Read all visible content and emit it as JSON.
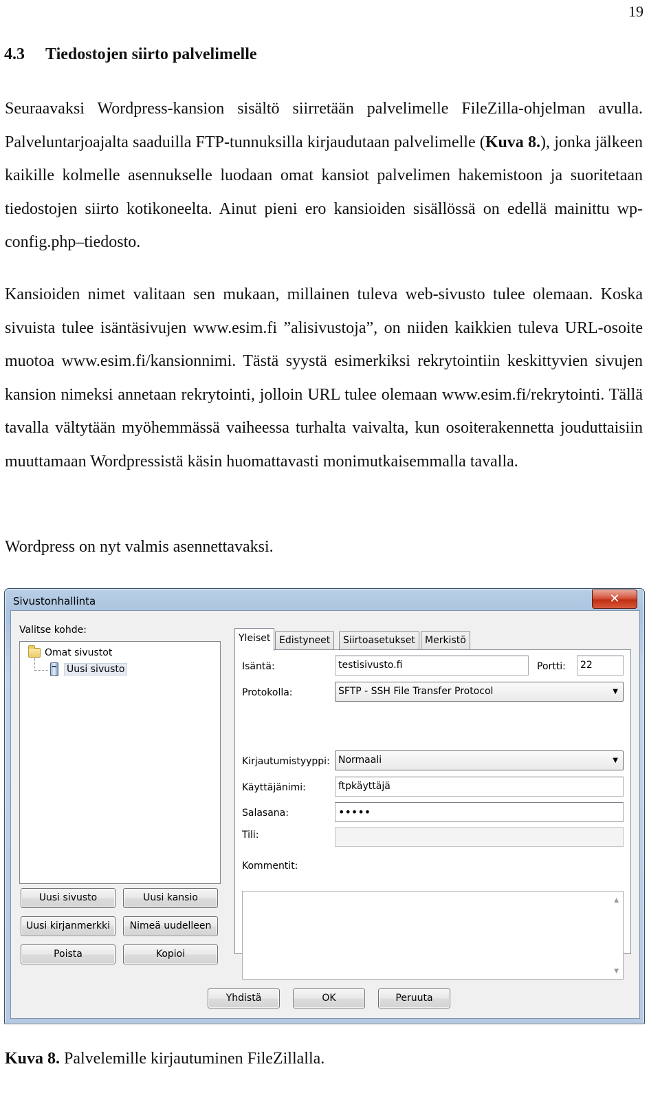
{
  "page_number": "19",
  "heading": {
    "number": "4.3",
    "title": "Tiedostojen siirto palvelimelle"
  },
  "paragraph1": {
    "a": "Seuraavaksi Wordpress-kansion sisältö siirretään palvelimelle FileZilla-ohjelman avulla. Palveluntarjoajalta saaduilla FTP-tunnuksilla kirjaudutaan palvelimelle (",
    "figure_ref": "Kuva 8.",
    "b": "), jonka jälkeen kaikille kolmelle asennukselle luodaan omat kansiot palvelimen hakemistoon ja suoritetaan tiedostojen siirto kotikoneelta. Ainut pieni ero kansioiden sisällössä on edellä mainittu wp-config.php–tiedosto."
  },
  "paragraph2": "Kansioiden nimet valitaan sen mukaan, millainen tuleva web-sivusto tulee olemaan. Koska sivuista tulee isäntäsivujen www.esim.fi ”alisivustoja”, on niiden kaikkien tuleva URL-osoite muotoa www.esim.fi/kansionnimi. Tästä syystä esimerkiksi rekrytointiin keskittyvien sivujen kansion nimeksi annetaan rekrytointi, jolloin URL tulee olemaan www.esim.fi/rekrytointi. Tällä tavalla vältytään myöhemmässä vaiheessa turhalta vaivalta, kun osoiterakennetta jouduttaisiin muuttamaan Wordpressistä käsin huomattavasti monimutkaisemmalla tavalla.",
  "paragraph3": "Wordpress on nyt valmis asennettavaksi.",
  "dialog": {
    "title": "Sivustonhallinta",
    "close_glyph": "✕",
    "tree": {
      "label": "Valitse kohde:",
      "root": "Omat sivustot",
      "child": "Uusi sivusto"
    },
    "left_buttons": {
      "new_site": "Uusi sivusto",
      "new_folder": "Uusi kansio",
      "new_bookmark": "Uusi kirjanmerkki",
      "rename": "Nimeä uudelleen",
      "delete": "Poista",
      "copy": "Kopioi"
    },
    "tabs": [
      "Yleiset",
      "Edistyneet",
      "Siirtoasetukset",
      "Merkistö"
    ],
    "form": {
      "host_label": "Isäntä:",
      "host_value": "testisivusto.fi",
      "port_label": "Portti:",
      "port_value": "22",
      "protocol_label": "Protokolla:",
      "protocol_value": "SFTP - SSH File Transfer Protocol",
      "logon_type_label": "Kirjautumistyyppi:",
      "logon_type_value": "Normaali",
      "user_label": "Käyttäjänimi:",
      "user_value": "ftpkäyttäjä",
      "password_label": "Salasana:",
      "password_value": "•••••",
      "account_label": "Tili:",
      "account_value": "",
      "comments_label": "Kommentit:"
    },
    "bottom_buttons": {
      "connect": "Yhdistä",
      "ok": "OK",
      "cancel": "Peruuta"
    }
  },
  "caption": {
    "label": "Kuva 8.",
    "text": "Palvelemille kirjautuminen FileZillalla."
  }
}
